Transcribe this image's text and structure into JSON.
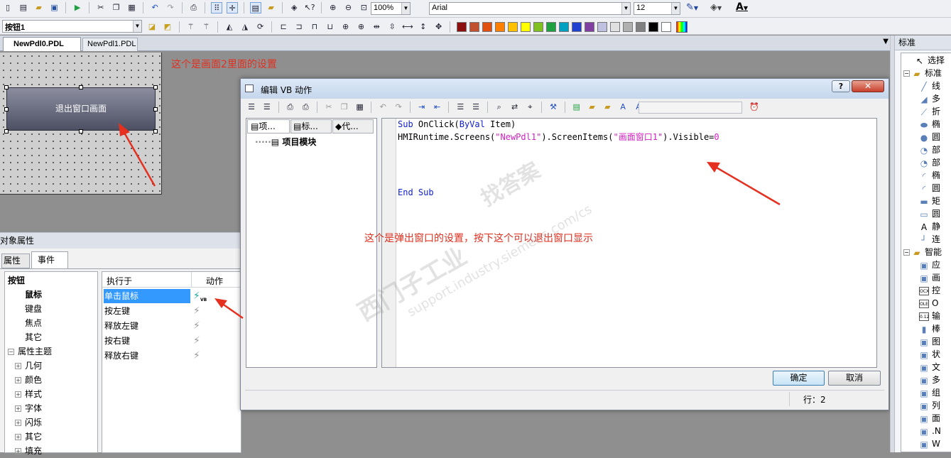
{
  "toolbar": {
    "zoom": "100%",
    "font_name": "Arial",
    "font_size": "12",
    "object_combo": "按钮1",
    "palette": [
      "#8b1010",
      "#c05030",
      "#e05010",
      "#ff8000",
      "#ffc000",
      "#ffff00",
      "#80c020",
      "#20a040",
      "#00a0c0",
      "#2040d0",
      "#8040a0",
      "#c0c0e0",
      "#e0e0e0",
      "#b0b0b0",
      "#808080",
      "#000000",
      "#ffffff"
    ]
  },
  "tabs": [
    {
      "label": "NewPdl0.PDL"
    },
    {
      "label": "NewPdl1.PDL"
    }
  ],
  "canvas": {
    "button_text": "退出窗口画面",
    "note_top": "这个是画面2里面的设置"
  },
  "props": {
    "title": "对象属性",
    "tab_attr": "属性",
    "tab_event": "事件",
    "tree": [
      {
        "label": "按钮",
        "indent": 0,
        "bold": true
      },
      {
        "label": "鼠标",
        "indent": 1,
        "bold": true
      },
      {
        "label": "键盘",
        "indent": 1
      },
      {
        "label": "焦点",
        "indent": 1
      },
      {
        "label": "其它",
        "indent": 1
      },
      {
        "label": "属性主题",
        "indent": 0,
        "expander": "minus"
      },
      {
        "label": "几何",
        "indent": 1,
        "expander": "plus"
      },
      {
        "label": "颜色",
        "indent": 1,
        "expander": "plus"
      },
      {
        "label": "样式",
        "indent": 1,
        "expander": "plus"
      },
      {
        "label": "字体",
        "indent": 1,
        "expander": "plus"
      },
      {
        "label": "闪烁",
        "indent": 1,
        "expander": "plus"
      },
      {
        "label": "其它",
        "indent": 1,
        "expander": "plus"
      },
      {
        "label": "填充",
        "indent": 1,
        "expander": "plus"
      }
    ],
    "col_exec": "执行于",
    "col_action": "动作",
    "events": [
      {
        "label": "单击鼠标",
        "selected": true,
        "action_badge": "VB"
      },
      {
        "label": "按左键"
      },
      {
        "label": "释放左键"
      },
      {
        "label": "按右键"
      },
      {
        "label": "释放右键"
      }
    ]
  },
  "dialog": {
    "title": "编辑 VB 动作",
    "help": "?",
    "tabs": [
      "项...",
      "标...",
      "代..."
    ],
    "project_node": "项目模块",
    "code": {
      "line1_kw1": "Sub",
      "line1_a": " OnClick(",
      "line1_kw2": "ByVal",
      "line1_b": " Item)",
      "line2_a": "HMIRuntime.Screens(",
      "line2_s1": "\"NewPdl1\"",
      "line2_b": ").ScreenItems(",
      "line2_s2": "\"画面窗口1\"",
      "line2_c": ").Visible=",
      "line2_n": "0",
      "line3": "End Sub"
    },
    "note": "这个是弹出窗口的设置，按下这个可以退出窗口显示",
    "ok": "确定",
    "cancel": "取消",
    "status": "行：2"
  },
  "watermark": [
    "西门子工业",
    "找答案",
    "support.industry.siemens.com/cs"
  ],
  "right_panel": {
    "header": "标准",
    "items": [
      {
        "label": "选择",
        "indent": 1,
        "icon": "arrow"
      },
      {
        "label": "标准",
        "indent": 0,
        "icon": "folder",
        "expander": "minus"
      },
      {
        "label": "线",
        "indent": 2,
        "icon": "line"
      },
      {
        "label": "多",
        "indent": 2,
        "icon": "poly"
      },
      {
        "label": "折",
        "indent": 2,
        "icon": "polyline"
      },
      {
        "label": "椭",
        "indent": 2,
        "icon": "ellipse"
      },
      {
        "label": "圆",
        "indent": 2,
        "icon": "circle"
      },
      {
        "label": "部",
        "indent": 2,
        "icon": "pie"
      },
      {
        "label": "部",
        "indent": 2,
        "icon": "pie"
      },
      {
        "label": "椭",
        "indent": 2,
        "icon": "arc"
      },
      {
        "label": "圆",
        "indent": 2,
        "icon": "arc"
      },
      {
        "label": "矩",
        "indent": 2,
        "icon": "rect"
      },
      {
        "label": "圆",
        "indent": 2,
        "icon": "rrect"
      },
      {
        "label": "静",
        "indent": 2,
        "icon": "text"
      },
      {
        "label": "连",
        "indent": 2,
        "icon": "conn"
      },
      {
        "label": "智能",
        "indent": 0,
        "icon": "folder",
        "expander": "minus"
      },
      {
        "label": "应",
        "indent": 2,
        "icon": "box"
      },
      {
        "label": "画",
        "indent": 2,
        "icon": "box"
      },
      {
        "label": "控",
        "indent": 2,
        "icon": "ocx"
      },
      {
        "label": "O",
        "indent": 2,
        "icon": "ole"
      },
      {
        "label": "输",
        "indent": 2,
        "icon": "io"
      },
      {
        "label": "棒",
        "indent": 2,
        "icon": "bar"
      },
      {
        "label": "图",
        "indent": 2,
        "icon": "box"
      },
      {
        "label": "状",
        "indent": 2,
        "icon": "box"
      },
      {
        "label": "文",
        "indent": 2,
        "icon": "box"
      },
      {
        "label": "多",
        "indent": 2,
        "icon": "box"
      },
      {
        "label": "组",
        "indent": 2,
        "icon": "box"
      },
      {
        "label": "列",
        "indent": 2,
        "icon": "box"
      },
      {
        "label": "面",
        "indent": 2,
        "icon": "box"
      },
      {
        "label": ".N",
        "indent": 2,
        "icon": "box"
      },
      {
        "label": "W",
        "indent": 2,
        "icon": "box"
      }
    ]
  }
}
